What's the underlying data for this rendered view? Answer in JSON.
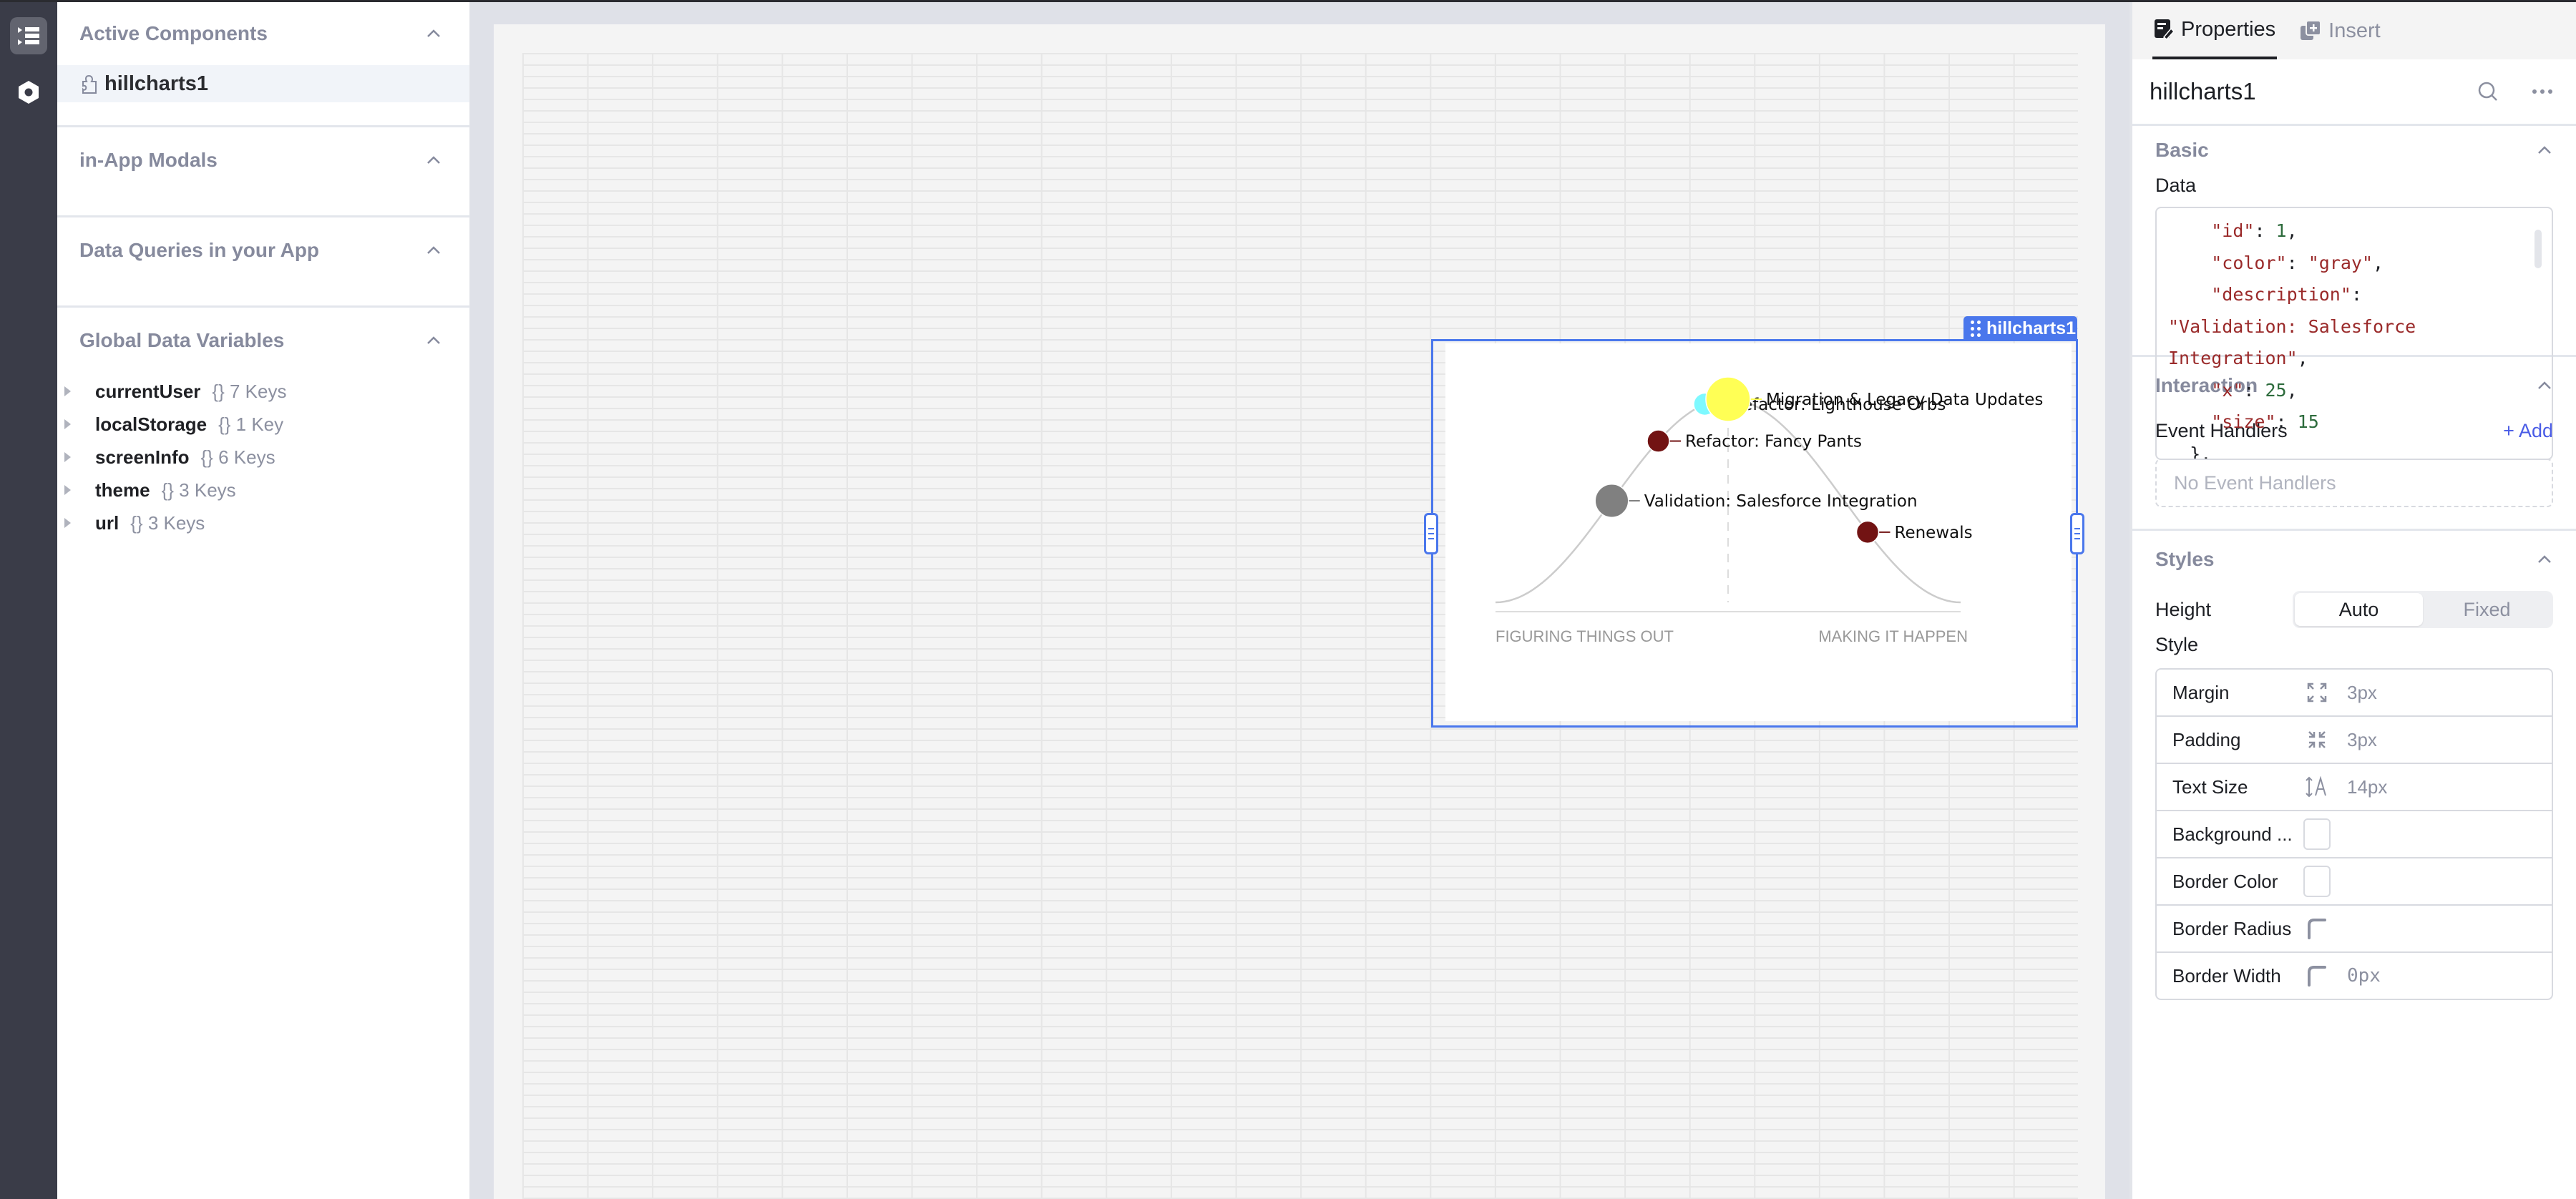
{
  "left_panel": {
    "sections": [
      {
        "title": "Active Components"
      },
      {
        "title": "in-App Modals"
      },
      {
        "title": "Data Queries in your App"
      },
      {
        "title": "Global Data Variables"
      }
    ],
    "active_components": [
      {
        "name": "hillcharts1",
        "icon": "puzzle-piece-icon"
      }
    ],
    "global_variables": [
      {
        "name": "currentUser",
        "meta": "{} 7 Keys"
      },
      {
        "name": "localStorage",
        "meta": "{} 1 Key"
      },
      {
        "name": "screenInfo",
        "meta": "{} 6 Keys"
      },
      {
        "name": "theme",
        "meta": "{} 3 Keys"
      },
      {
        "name": "url",
        "meta": "{} 3 Keys"
      }
    ]
  },
  "rail": {
    "items": [
      {
        "icon": "component-tree-icon",
        "active": true
      },
      {
        "icon": "settings-hexagon-icon",
        "active": false
      }
    ]
  },
  "canvas": {
    "selected_component": "hillcharts1",
    "selection_color": "#4a77ec"
  },
  "chart_data": {
    "type": "scatter",
    "title": "",
    "xlabel_left": "FIGURING THINGS OUT",
    "xlabel_right": "MAKING IT HAPPEN",
    "xlim": [
      0,
      100
    ],
    "curve": "bell",
    "divider_x": 50,
    "points": [
      {
        "id": 1,
        "description": "Validation: Salesforce Integration",
        "color": "gray",
        "x": 25,
        "size": 15
      },
      {
        "description": "Refactor: Fancy Pants",
        "color": "#721313",
        "x": 35,
        "size": 10
      },
      {
        "description": "Refactor: Lighthouse Orbs",
        "color": "#7ef9ff",
        "x": 45,
        "size": 10
      },
      {
        "description": "Migration & Legacy Data Updates",
        "color": "#ffff55",
        "x": 50,
        "size": 20
      },
      {
        "description": "Renewals",
        "color": "#721313",
        "x": 80,
        "size": 10
      }
    ]
  },
  "right_panel": {
    "tabs": [
      {
        "label": "Properties",
        "icon": "properties-icon",
        "active": true
      },
      {
        "label": "Insert",
        "icon": "insert-icon",
        "active": false
      }
    ],
    "component_name": "hillcharts1",
    "basic": {
      "title": "Basic",
      "data_label": "Data",
      "code_lines": [
        {
          "indent": "    ",
          "key": "\"id\"",
          "sep": ": ",
          "value": "1",
          "vtype": "n",
          "tail": ","
        },
        {
          "indent": "    ",
          "key": "\"color\"",
          "sep": ": ",
          "value": "\"gray\"",
          "vtype": "s",
          "tail": ","
        },
        {
          "indent": "    ",
          "key": "\"description\"",
          "sep": ":",
          "value": "",
          "vtype": "s",
          "tail": ""
        },
        {
          "indent": "",
          "key": "",
          "sep": "",
          "value": "\"Validation: Salesforce",
          "vtype": "s",
          "tail": ""
        },
        {
          "indent": "",
          "key": "",
          "sep": "",
          "value": "Integration\"",
          "vtype": "s",
          "tail": ","
        },
        {
          "indent": "    ",
          "key": "\"x\"",
          "sep": ": ",
          "value": "25",
          "vtype": "n",
          "tail": ","
        },
        {
          "indent": "    ",
          "key": "\"size\"",
          "sep": ": ",
          "value": "15",
          "vtype": "n",
          "tail": ""
        },
        {
          "indent": "  ",
          "key": "",
          "sep": "",
          "value": "},",
          "vtype": "p",
          "tail": ""
        }
      ]
    },
    "interaction": {
      "title": "Interaction",
      "event_handlers_label": "Event Handlers",
      "add_label": "+ Add",
      "empty_label": "No Event Handlers"
    },
    "styles": {
      "title": "Styles",
      "height_label": "Height",
      "height_options": [
        "Auto",
        "Fixed"
      ],
      "height_selected": "Auto",
      "style_label": "Style",
      "rows": [
        {
          "label": "Margin",
          "icon": "expand-arrows-icon",
          "value": "3px"
        },
        {
          "label": "Padding",
          "icon": "collapse-arrows-icon",
          "value": "3px"
        },
        {
          "label": "Text Size",
          "icon": "text-size-icon",
          "value": "14px"
        },
        {
          "label": "Background ...",
          "icon": "color-swatch",
          "value": ""
        },
        {
          "label": "Border Color",
          "icon": "color-swatch",
          "value": ""
        },
        {
          "label": "Border Radius",
          "icon": "border-radius-icon",
          "value": ""
        },
        {
          "label": "Border Width",
          "icon": "border-width-icon",
          "value": "0px"
        }
      ]
    }
  }
}
